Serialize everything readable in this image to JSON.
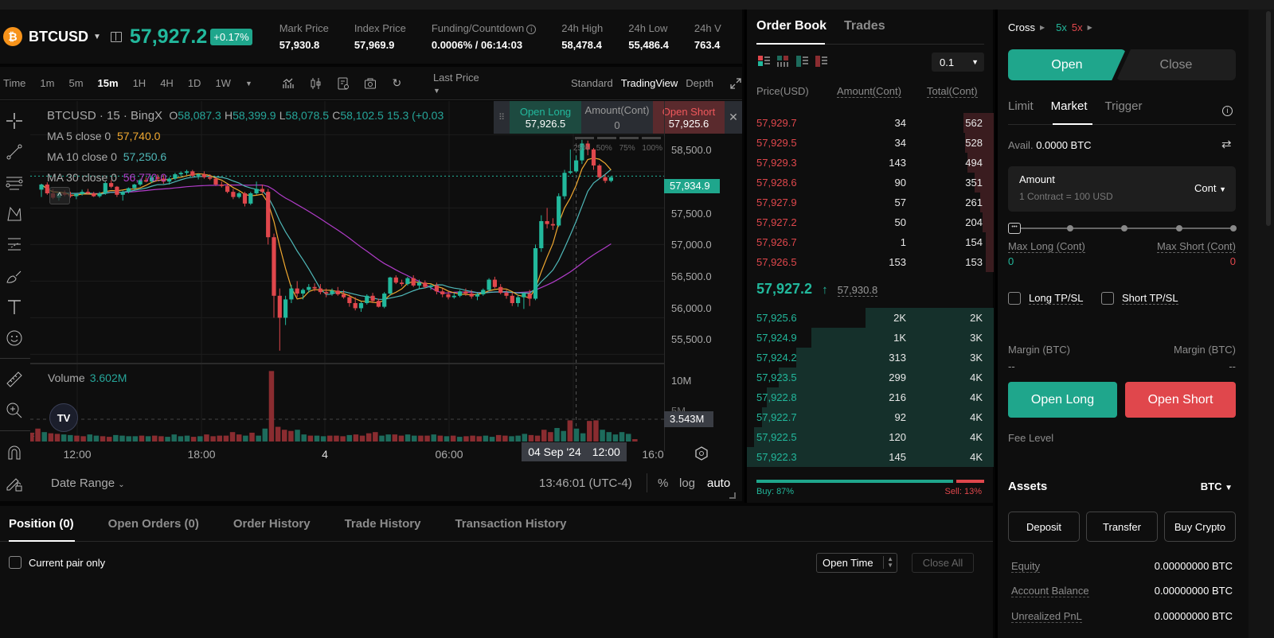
{
  "header": {
    "symbol": "BTCUSD",
    "coin_icon": "bitcoin-icon",
    "last_price": "57,927.2",
    "change_pct": "+0.17%",
    "stats": [
      {
        "label": "Mark Price",
        "value": "57,930.8"
      },
      {
        "label": "Index Price",
        "value": "57,969.9"
      },
      {
        "label": "Funding/Countdown",
        "value": "0.0006% / 06:14:03",
        "has_info": true
      },
      {
        "label": "24h High",
        "value": "58,478.4"
      },
      {
        "label": "24h Low",
        "value": "55,486.4"
      },
      {
        "label": "24h V",
        "value": "763.4"
      }
    ]
  },
  "chart_toolbar": {
    "time_label": "Time",
    "timeframes": [
      "1m",
      "5m",
      "15m",
      "1H",
      "4H",
      "1D",
      "1W"
    ],
    "active_timeframe": "15m",
    "price_type": "Last Price",
    "views": [
      "Standard",
      "TradingView",
      "Depth"
    ],
    "active_view": "TradingView"
  },
  "chart": {
    "legend_title": "BTCUSD · 15 · BingX",
    "ohlc": {
      "o": "58,087.3",
      "h": "58,399.9",
      "l": "58,078.5",
      "c": "58,102.5",
      "chg": "15.3 (+0.03"
    },
    "ma": [
      {
        "label": "MA 5 close 0",
        "value": "57,740.0",
        "color": "#f0a830"
      },
      {
        "label": "MA 10 close 0",
        "value": "57,250.6",
        "color": "#4fb8b8"
      },
      {
        "label": "MA 30 close 0",
        "value": "56,770.0",
        "color": "#b03cc8"
      }
    ],
    "quick_trade": {
      "long_label": "Open Long",
      "long_price": "57,926.5",
      "amount_label": "Amount(Cont)",
      "amount_value": "0",
      "short_label": "Open Short",
      "short_price": "57,925.6",
      "pcts": [
        "25%",
        "50%",
        "75%",
        "100%"
      ]
    },
    "price_ticks": [
      "58,500.0",
      "57,500.0",
      "57,000.0",
      "56,500.0",
      "56,000.0",
      "55,500.0"
    ],
    "last_price_tag": "57,934.9",
    "volume_label": "Volume",
    "volume_value": "3.602M",
    "volume_ticks": [
      "10M",
      "5M"
    ],
    "volume_tag": "3.543M",
    "time_ticks": [
      "12:00",
      "18:00",
      "4",
      "06:00",
      "16:0"
    ],
    "crosshair_date": "04 Sep '24",
    "crosshair_time": "12:00",
    "date_range": "Date Range",
    "clock": "13:46:01 (UTC-4)",
    "scale_opts": [
      "%",
      "log",
      "auto"
    ]
  },
  "chart_data": {
    "type": "candlestick",
    "title": "BTCUSD · 15 · BingX",
    "ylim": [
      55200,
      58700
    ],
    "ma_series": [
      "MA 5",
      "MA 10",
      "MA 30"
    ],
    "candles_note": "approximate 15m OHLC read from chart",
    "candles": [
      [
        57750,
        57830,
        57650,
        57820
      ],
      [
        57820,
        57850,
        57680,
        57700
      ],
      [
        57700,
        57760,
        57620,
        57640
      ],
      [
        57640,
        57720,
        57600,
        57700
      ],
      [
        57700,
        57740,
        57660,
        57680
      ],
      [
        57680,
        57720,
        57640,
        57660
      ],
      [
        57660,
        57700,
        57620,
        57690
      ],
      [
        57690,
        57750,
        57670,
        57720
      ],
      [
        57720,
        57760,
        57680,
        57700
      ],
      [
        57700,
        57720,
        57650,
        57660
      ],
      [
        57660,
        57720,
        57640,
        57700
      ],
      [
        57700,
        57860,
        57680,
        57840
      ],
      [
        57840,
        57880,
        57770,
        57790
      ],
      [
        57790,
        57800,
        57650,
        57680
      ],
      [
        57680,
        57740,
        57600,
        57720
      ],
      [
        57720,
        57780,
        57700,
        57770
      ],
      [
        57770,
        57830,
        57740,
        57820
      ],
      [
        57820,
        57900,
        57800,
        57880
      ],
      [
        57880,
        57920,
        57850,
        57860
      ],
      [
        57860,
        57940,
        57840,
        57920
      ],
      [
        57920,
        57960,
        57880,
        57900
      ],
      [
        57900,
        57950,
        57830,
        57860
      ],
      [
        57860,
        57920,
        57820,
        57900
      ],
      [
        57900,
        57980,
        57880,
        57960
      ],
      [
        57960,
        58000,
        57930,
        57980
      ],
      [
        57980,
        58020,
        57950,
        58000
      ],
      [
        58000,
        58020,
        57920,
        57940
      ],
      [
        57940,
        57970,
        57890,
        57960
      ],
      [
        57960,
        58000,
        57900,
        57920
      ],
      [
        57920,
        57960,
        57880,
        57900
      ],
      [
        57900,
        57920,
        57800,
        57820
      ],
      [
        57820,
        57860,
        57780,
        57800
      ],
      [
        57800,
        57830,
        57700,
        57720
      ],
      [
        57720,
        57760,
        57620,
        57650
      ],
      [
        57650,
        57720,
        57630,
        57700
      ],
      [
        57700,
        57720,
        57520,
        57560
      ],
      [
        57560,
        57720,
        57540,
        57700
      ],
      [
        57700,
        57860,
        57680,
        57760
      ],
      [
        57760,
        57820,
        57700,
        57720
      ],
      [
        57720,
        57760,
        57000,
        57100
      ],
      [
        57100,
        57150,
        56000,
        56300
      ],
      [
        56300,
        56400,
        55550,
        56000
      ],
      [
        56000,
        56300,
        55900,
        56250
      ],
      [
        56250,
        56450,
        56200,
        56400
      ],
      [
        56400,
        56500,
        56280,
        56330
      ],
      [
        56330,
        56400,
        56250,
        56380
      ],
      [
        56380,
        56460,
        56340,
        56420
      ],
      [
        56420,
        56470,
        56360,
        56400
      ],
      [
        56400,
        56460,
        56320,
        56350
      ],
      [
        56350,
        56400,
        56280,
        56330
      ],
      [
        56330,
        56400,
        56300,
        56370
      ],
      [
        56370,
        56420,
        56300,
        56320
      ],
      [
        56320,
        56380,
        56260,
        56280
      ],
      [
        56280,
        56320,
        56150,
        56200
      ],
      [
        56200,
        56280,
        56100,
        56130
      ],
      [
        56130,
        56220,
        56080,
        56200
      ],
      [
        56200,
        56320,
        56180,
        56300
      ],
      [
        56300,
        56340,
        56200,
        56230
      ],
      [
        56230,
        56260,
        56140,
        56150
      ],
      [
        56150,
        56350,
        56130,
        56330
      ],
      [
        56330,
        56560,
        56300,
        56550
      ],
      [
        56550,
        56580,
        56460,
        56480
      ],
      [
        56480,
        56520,
        56430,
        56460
      ],
      [
        56460,
        56560,
        56440,
        56540
      ],
      [
        56540,
        56580,
        56420,
        56440
      ],
      [
        56440,
        56520,
        56400,
        56480
      ],
      [
        56480,
        56510,
        56400,
        56420
      ],
      [
        56420,
        56460,
        56380,
        56440
      ],
      [
        56440,
        56480,
        56320,
        56360
      ],
      [
        56360,
        56400,
        56280,
        56320
      ],
      [
        56320,
        56360,
        56250,
        56280
      ],
      [
        56280,
        56340,
        56260,
        56300
      ],
      [
        56300,
        56380,
        56280,
        56360
      ],
      [
        56360,
        56400,
        56300,
        56330
      ],
      [
        56330,
        56380,
        56260,
        56290
      ],
      [
        56290,
        56340,
        56240,
        56320
      ],
      [
        56320,
        56400,
        56300,
        56380
      ],
      [
        56380,
        56540,
        56360,
        56520
      ],
      [
        56520,
        56560,
        56400,
        56420
      ],
      [
        56420,
        56460,
        56320,
        56340
      ],
      [
        56340,
        56380,
        56260,
        56300
      ],
      [
        56300,
        56340,
        56160,
        56200
      ],
      [
        56200,
        56310,
        56150,
        56280
      ],
      [
        56280,
        56350,
        56120,
        56330
      ],
      [
        56330,
        56380,
        56160,
        56260
      ],
      [
        56260,
        57000,
        56240,
        56950
      ],
      [
        56950,
        57400,
        56900,
        57320
      ],
      [
        57320,
        57500,
        57220,
        57280
      ],
      [
        57280,
        57360,
        57200,
        57260
      ],
      [
        57260,
        57700,
        57240,
        57660
      ],
      [
        57660,
        58020,
        57620,
        57980
      ],
      [
        57980,
        58300,
        57960,
        58000
      ],
      [
        58000,
        58220,
        57980,
        58150
      ],
      [
        58150,
        58430,
        58100,
        58380
      ],
      [
        58380,
        58420,
        58220,
        58300
      ],
      [
        58300,
        58320,
        58020,
        58080
      ],
      [
        58080,
        58100,
        57900,
        57920
      ],
      [
        57920,
        57960,
        57840,
        57870
      ],
      [
        57870,
        57940,
        57850,
        57920
      ]
    ],
    "volumes_M": [
      3.5,
      1.5,
      2.2,
      1.6,
      1.4,
      1.3,
      1.2,
      1.1,
      1.0,
      0.9,
      1.2,
      1.0,
      0.9,
      0.8,
      1.1,
      1.0,
      0.9,
      0.9,
      1.0,
      0.9,
      1.0,
      0.9,
      0.8,
      1.2,
      0.9,
      1.0,
      0.8,
      0.9,
      1.2,
      0.9,
      1.0,
      1.0,
      1.6,
      1.2,
      1.0,
      1.5,
      1.0,
      2.2,
      12.0,
      2.5,
      2.0,
      1.8,
      2.0,
      1.2,
      1.0,
      1.0,
      0.9,
      1.0,
      1.0,
      0.9,
      1.1,
      1.2,
      1.0,
      1.4,
      1.6,
      1.0,
      1.2,
      1.2,
      1.0,
      1.2,
      1.0,
      1.0,
      1.0,
      1.2,
      1.0,
      0.9,
      1.0,
      0.8,
      0.9,
      1.0,
      0.9,
      1.0,
      0.8,
      1.1,
      1.0,
      0.9,
      1.0,
      1.3,
      1.1,
      1.0,
      2.0,
      1.6,
      2.3,
      1.8,
      3.6,
      2.2,
      1.4,
      3.5,
      3.6,
      2.0,
      1.6,
      1.2,
      1.6,
      1.3,
      0.4
    ],
    "volume_ylim": [
      0,
      13
    ]
  },
  "orderbook": {
    "tabs": [
      "Order Book",
      "Trades"
    ],
    "active_tab": "Order Book",
    "precision": "0.1",
    "headers": [
      "Price(USD)",
      "Amount(Cont)",
      "Total(Cont)"
    ],
    "asks": [
      {
        "price": "57,929.7",
        "amount": "34",
        "total": "562",
        "depth": 1.0
      },
      {
        "price": "57,929.5",
        "amount": "34",
        "total": "528",
        "depth": 0.94
      },
      {
        "price": "57,929.3",
        "amount": "143",
        "total": "494",
        "depth": 0.88
      },
      {
        "price": "57,928.6",
        "amount": "90",
        "total": "351",
        "depth": 0.62
      },
      {
        "price": "57,927.9",
        "amount": "57",
        "total": "261",
        "depth": 0.46
      },
      {
        "price": "57,927.2",
        "amount": "50",
        "total": "204",
        "depth": 0.36
      },
      {
        "price": "57,926.7",
        "amount": "1",
        "total": "154",
        "depth": 0.27
      },
      {
        "price": "57,926.5",
        "amount": "153",
        "total": "153",
        "depth": 0.27
      }
    ],
    "mid_price": "57,927.2",
    "mark_price": "57,930.8",
    "bids": [
      {
        "price": "57,925.6",
        "amount": "2K",
        "total": "2K",
        "depth": 0.52
      },
      {
        "price": "57,924.9",
        "amount": "1K",
        "total": "3K",
        "depth": 0.74
      },
      {
        "price": "57,924.2",
        "amount": "313",
        "total": "3K",
        "depth": 0.8
      },
      {
        "price": "57,923.5",
        "amount": "299",
        "total": "4K",
        "depth": 0.87
      },
      {
        "price": "57,922.8",
        "amount": "216",
        "total": "4K",
        "depth": 0.92
      },
      {
        "price": "57,922.7",
        "amount": "92",
        "total": "4K",
        "depth": 0.94
      },
      {
        "price": "57,922.5",
        "amount": "120",
        "total": "4K",
        "depth": 0.97
      },
      {
        "price": "57,922.3",
        "amount": "145",
        "total": "4K",
        "depth": 1.0
      }
    ],
    "buy_pct": 87,
    "buy_label": "Buy: 87%",
    "sell_label": "Sell: 13%"
  },
  "trade_panel": {
    "margin_mode": "Cross",
    "long_leverage": "5x",
    "short_leverage": "5x",
    "open_label": "Open",
    "close_label": "Close",
    "order_types": [
      "Limit",
      "Market",
      "Trigger"
    ],
    "active_order_type": "Market",
    "avail_label": "Avail.",
    "avail_value": "0.0000 BTC",
    "amount_label": "Amount",
    "amount_placeholder": "1 Contract = 100 USD",
    "amount_unit": "Cont",
    "slider_value_pct": 0,
    "max_long_label": "Max Long (Cont)",
    "max_long_value": "0",
    "max_short_label": "Max Short (Cont)",
    "max_short_value": "0",
    "long_tpsl": "Long TP/SL",
    "short_tpsl": "Short TP/SL",
    "margin_label": "Margin (BTC)",
    "margin_long": "--",
    "margin_short": "--",
    "open_long": "Open Long",
    "open_short": "Open Short",
    "fee_level": "Fee Level",
    "assets_title": "Assets",
    "assets_currency": "BTC",
    "asset_buttons": [
      "Deposit",
      "Transfer",
      "Buy Crypto"
    ],
    "asset_rows": [
      {
        "label": "Equity",
        "value": "0.00000000 BTC"
      },
      {
        "label": "Account Balance",
        "value": "0.00000000 BTC"
      },
      {
        "label": "Unrealized PnL",
        "value": "0.00000000 BTC"
      }
    ]
  },
  "positions": {
    "tabs": [
      "Position (0)",
      "Open Orders (0)",
      "Order History",
      "Trade History",
      "Transaction History"
    ],
    "active_tab": "Position (0)",
    "current_pair_only": "Current pair only",
    "sort_label": "Open Time",
    "close_all": "Close All"
  },
  "colors": {
    "up": "#22b89c",
    "down": "#e0474c",
    "bg": "#0e0e0e"
  }
}
